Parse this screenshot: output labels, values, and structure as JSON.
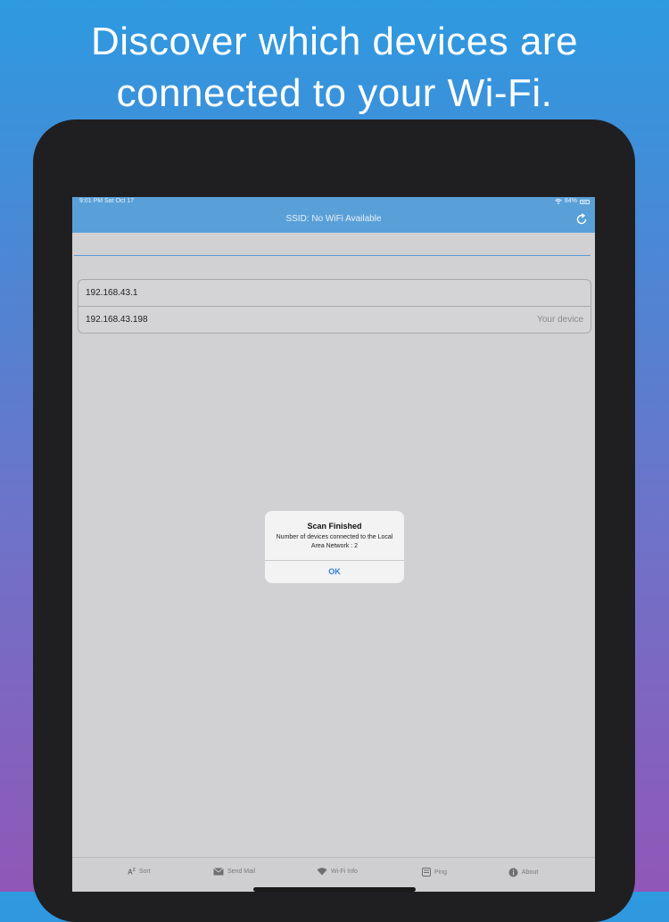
{
  "headline": {
    "line1": "Discover which devices are",
    "line2": "connected to your Wi-Fi."
  },
  "statusbar": {
    "time": "9:01 PM  Sat Oct 17",
    "battery": "84%"
  },
  "navbar": {
    "title": "SSID: No WiFi Available",
    "refresh_icon": "refresh-icon"
  },
  "devices": [
    {
      "ip": "192.168.43.1",
      "note": ""
    },
    {
      "ip": "192.168.43.198",
      "note": "Your device"
    }
  ],
  "alert": {
    "title": "Scan Finished",
    "message": "Number of devices connected to the Local Area Network : 2",
    "button": "OK"
  },
  "tabs": [
    {
      "label": "Sort",
      "icon": "az-sort-icon"
    },
    {
      "label": "Send Mail",
      "icon": "mail-icon"
    },
    {
      "label": "Wi-Fi Info",
      "icon": "wifi-icon"
    },
    {
      "label": "Ping",
      "icon": "ping-icon"
    },
    {
      "label": "About",
      "icon": "info-icon"
    }
  ],
  "colors": {
    "accent": "#5aa0d8",
    "alert_button": "#2f7fd8"
  }
}
